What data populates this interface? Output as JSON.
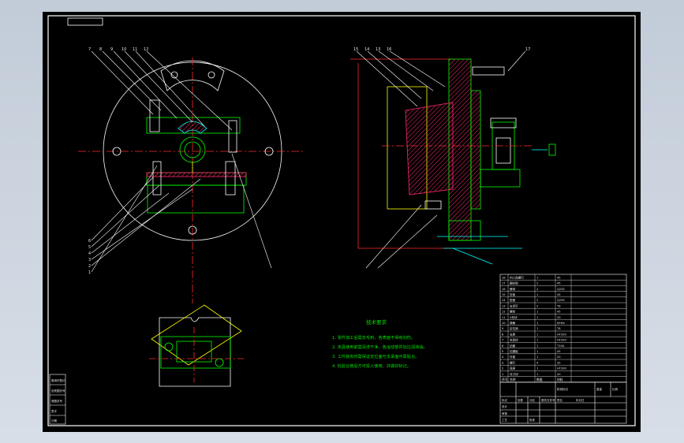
{
  "notes": {
    "title": "技术要求",
    "lines": [
      "1. 零件加工后需去毛刺，各表面不得有划伤。",
      "2. 夹具使用前需清洗干净，各运动部件加注润滑油。",
      "3. 工件装夹时需保证定位面与支承面可靠贴合。",
      "4. 检验合格后方可投入使用，并做好标记。"
    ]
  },
  "balloons_top": [
    "7",
    "8",
    "9",
    "10",
    "11",
    "12"
  ],
  "balloons_left": [
    "6",
    "5",
    "4",
    "3",
    "2",
    "1"
  ],
  "balloons_right_view": [
    "15",
    "14",
    "13",
    "16",
    "17"
  ],
  "bom": {
    "rows": [
      [
        "18",
        "内六角螺钉",
        "1",
        "45"
      ],
      [
        "17",
        "圆柱销",
        "2",
        "45"
      ],
      [
        "16",
        "螺母",
        "2",
        "Q235"
      ],
      [
        "15",
        "压板",
        "1",
        "45"
      ],
      [
        "14",
        "垫圈",
        "2",
        "Q235"
      ],
      [
        "13",
        "支承钉",
        "2",
        "T8"
      ],
      [
        "12",
        "螺栓",
        "1",
        "45"
      ],
      [
        "11",
        "V形块",
        "1",
        "20"
      ],
      [
        "10",
        "弹簧",
        "1",
        "65Mn"
      ],
      [
        "9",
        "定位销",
        "1",
        "T8"
      ],
      [
        "8",
        "支座",
        "1",
        "HT200"
      ],
      [
        "7",
        "夹具体",
        "1",
        "HT200"
      ],
      [
        "6",
        "钻套",
        "1",
        "T10A"
      ],
      [
        "5",
        "钻模板",
        "1",
        "45"
      ],
      [
        "4",
        "衬套",
        "1",
        "20"
      ],
      [
        "3",
        "螺钉",
        "4",
        "35"
      ],
      [
        "2",
        "底座",
        "1",
        "HT200"
      ],
      [
        "1",
        "对刀块",
        "1",
        "20"
      ]
    ],
    "header": [
      "序号",
      "名称",
      "数量",
      "材料"
    ]
  },
  "title_block": {
    "labels": [
      "标记",
      "处数",
      "分区",
      "更改文件号",
      "签名",
      "年月日"
    ],
    "roles": [
      "设计",
      "审核",
      "工艺",
      "批准"
    ],
    "meta": [
      "阶段标记",
      "重量",
      "比例"
    ]
  },
  "side_block": [
    "借用件登记",
    "旧底图总号",
    "底图总号",
    "签字",
    "日期"
  ],
  "colors": {
    "line": "#ffffff",
    "part": "#00ff00",
    "hatch": "#ff2a6a",
    "center": "#ff2a2a",
    "dim": "#00ffff",
    "accent": "#ffff00"
  }
}
